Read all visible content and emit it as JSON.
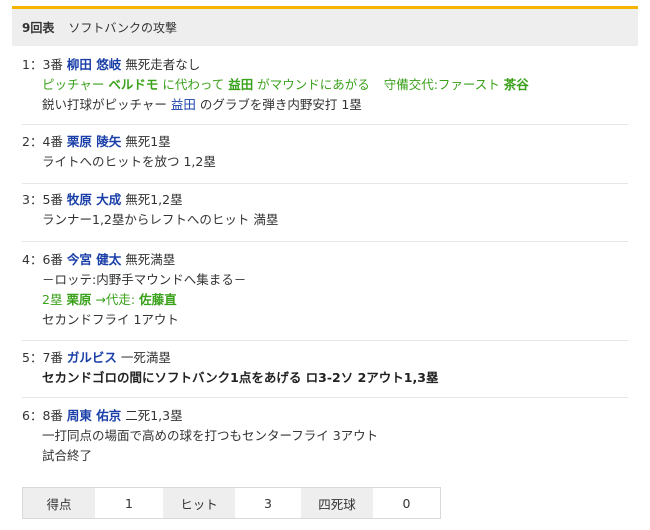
{
  "header": {
    "inning": "9回表",
    "title": "ソフトバンクの攻撃"
  },
  "plays": [
    {
      "num": "1：3番",
      "batter": "柳田 悠岐",
      "situation": "無死走者なし",
      "change_a": "ピッチャー ",
      "change_b": "ベルドモ",
      "change_c": " に代わって ",
      "change_d": "益田",
      "change_e": " がマウンドにあがる",
      "change_f": "守備交代:ファースト ",
      "change_g": "茶谷",
      "result_a": "鋭い打球がピッチャー ",
      "result_b": "益田",
      "result_c": " のグラブを弾き内野安打 1塁"
    },
    {
      "num": "2：4番",
      "batter": "栗原 陵矢",
      "situation": "無死1塁",
      "result": "ライトへのヒットを放つ 1,2塁"
    },
    {
      "num": "3：5番",
      "batter": "牧原 大成",
      "situation": "無死1,2塁",
      "result": "ランナー1,2塁からレフトへのヒット 満塁"
    },
    {
      "num": "4：6番",
      "batter": "今宮 健太",
      "situation": "無死満塁",
      "note": "－ロッテ:内野手マウンドへ集まる－",
      "sub_a": "2塁 ",
      "sub_b": "栗原",
      "sub_c": " →代走: ",
      "sub_d": "佐藤直",
      "result": "セカンドフライ 1アウト"
    },
    {
      "num": "5：7番",
      "batter": "ガルビス",
      "situation": "一死満塁",
      "result": "セカンドゴロの間にソフトバンク1点をあげる ロ3-2ソ 2アウト1,3塁"
    },
    {
      "num": "6：8番",
      "batter": "周東 佑京",
      "situation": "二死1,3塁",
      "result": "一打同点の場面で高めの球を打つもセンターフライ 3アウト",
      "end": "試合終了"
    }
  ],
  "score": {
    "runs_label": "得点",
    "runs": "1",
    "hits_label": "ヒット",
    "hits": "3",
    "walks_label": "四死球",
    "walks": "0"
  },
  "colors": {
    "accent": "#f5b400",
    "player": "#1a3fa8",
    "change": "#3aa11b"
  }
}
